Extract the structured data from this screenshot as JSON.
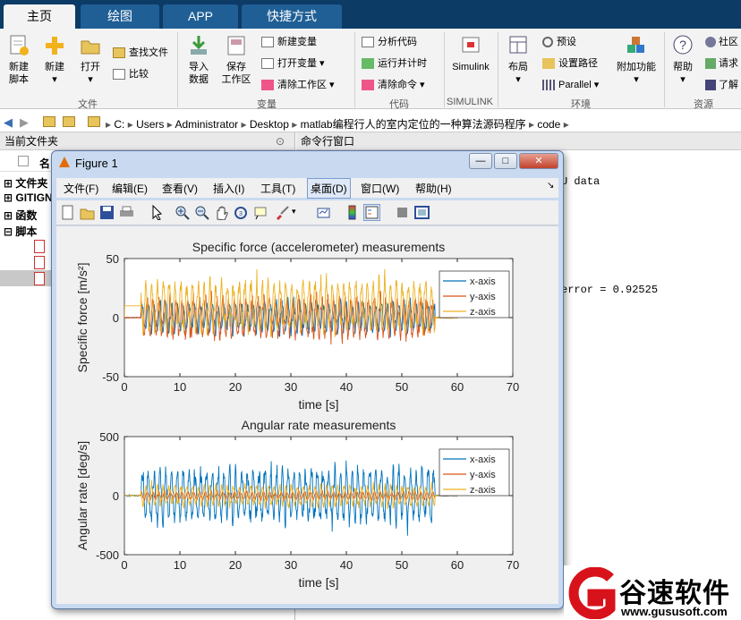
{
  "tabs": [
    "主页",
    "绘图",
    "APP",
    "快捷方式"
  ],
  "ribbon": {
    "new_script": "新建\n脚本",
    "new": "新建",
    "open": "打开",
    "find_files": "查找文件",
    "compare": "比较",
    "import_data": "导入\n数据",
    "save_workspace": "保存\n工作区",
    "new_variable": "新建变量",
    "open_variable": "打开变量",
    "clear_workspace": "清除工作区",
    "analyze_code": "分析代码",
    "run_time": "运行并计时",
    "clear_commands": "清除命令",
    "simulink": "Simulink",
    "layout": "布局",
    "preferences": "预设",
    "set_path": "设置路径",
    "parallel": "Parallel",
    "addons": "附加功能",
    "help": "帮助",
    "community": "社区",
    "request": "请求",
    "learn": "了解",
    "sections": [
      "文件",
      "变量",
      "代码",
      "SIMULINK",
      "环境",
      "资源"
    ]
  },
  "address": {
    "path": [
      "C:",
      "Users",
      "Administrator",
      "Desktop",
      "matlab编程行人的室内定位的一种算法源码程序",
      "code"
    ]
  },
  "current_folder": {
    "title": "当前文件夹",
    "col_name": "名",
    "items": [
      "文件夹",
      "GITIGN",
      "函数",
      "脚本"
    ]
  },
  "command_window": {
    "title": "命令行窗口",
    "lines": [
      "U data",
      "error = 0.92525"
    ]
  },
  "figure": {
    "title": "Figure 1",
    "menu": [
      "文件(F)",
      "编辑(E)",
      "查看(V)",
      "插入(I)",
      "工具(T)",
      "桌面(D)",
      "窗口(W)",
      "帮助(H)"
    ],
    "win_min": "—",
    "win_max": "□",
    "win_close": "✕"
  },
  "chart_data": [
    {
      "type": "line",
      "title": "Specific force (accelerometer) measurements",
      "xlabel": "time [s]",
      "ylabel": "Specific force [m/s²]",
      "xlim": [
        0,
        70
      ],
      "ylim": [
        -50,
        50
      ],
      "xticks": [
        0,
        10,
        20,
        30,
        40,
        50,
        60,
        70
      ],
      "yticks": [
        -50,
        0,
        50
      ],
      "legend_position": "top-right",
      "series": [
        {
          "name": "x-axis",
          "color": "#0072bd",
          "base": 0,
          "amp": 22,
          "period": 1.05
        },
        {
          "name": "y-axis",
          "color": "#d95319",
          "base": 0,
          "amp": 30,
          "period": 1.05
        },
        {
          "name": "z-axis",
          "color": "#edb120",
          "base": 10,
          "amp": 35,
          "period": 1.05
        }
      ],
      "active_range": [
        3,
        56
      ]
    },
    {
      "type": "line",
      "title": "Angular rate measurements",
      "xlabel": "time [s]",
      "ylabel": "Angular rate  [deg/s]",
      "xlim": [
        0,
        70
      ],
      "ylim": [
        -500,
        500
      ],
      "xticks": [
        0,
        10,
        20,
        30,
        40,
        50,
        60,
        70
      ],
      "yticks": [
        -500,
        0,
        500
      ],
      "legend_position": "top-right",
      "series": [
        {
          "name": "x-axis",
          "color": "#0072bd",
          "base": 0,
          "amp": 380,
          "period": 1.05
        },
        {
          "name": "y-axis",
          "color": "#d95319",
          "base": 0,
          "amp": 60,
          "period": 1.05
        },
        {
          "name": "z-axis",
          "color": "#edb120",
          "base": 0,
          "amp": 150,
          "period": 1.05
        }
      ],
      "active_range": [
        3,
        56
      ]
    }
  ],
  "watermark": {
    "brand": "谷速软件",
    "url": "www.gususoft.com"
  }
}
